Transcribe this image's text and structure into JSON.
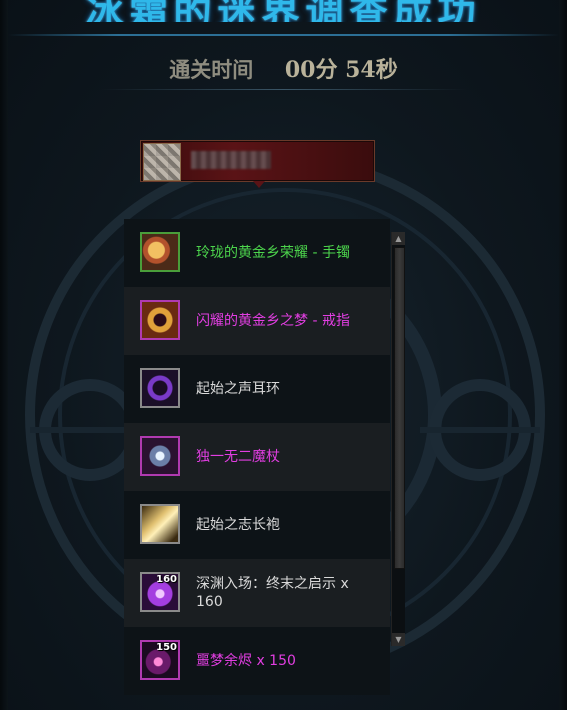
{
  "banner": {
    "title": "冰霜的迷界调查成功"
  },
  "clear_time": {
    "label": "通关时间",
    "value": "00分 54秒"
  },
  "player": {
    "name": ""
  },
  "rewards": [
    {
      "name": "玲珑的黄金乡荣耀 - 手镯",
      "quality": "epic",
      "icon": "bracelet-icon",
      "qty": ""
    },
    {
      "name": "闪耀的黄金乡之梦 - 戒指",
      "quality": "legend",
      "icon": "ring-icon",
      "qty": ""
    },
    {
      "name": "起始之声耳环",
      "quality": "unique",
      "icon": "earring-icon",
      "qty": ""
    },
    {
      "name": "独一无二魔杖",
      "quality": "legend",
      "icon": "wand-icon",
      "qty": ""
    },
    {
      "name": "起始之志长袍",
      "quality": "unique",
      "icon": "robe-icon",
      "qty": ""
    },
    {
      "name": "深渊入场：终末之启示 x 160",
      "quality": "unique",
      "icon": "abyss-orb-icon",
      "qty": "160"
    },
    {
      "name": "噩梦余烬 x 150",
      "quality": "legend",
      "icon": "ember-icon",
      "qty": "150"
    }
  ],
  "colors": {
    "epic": "#4cd44c",
    "legend": "#e13ee1",
    "unique": "#d9d9d9",
    "banner": "#2fb8ea"
  }
}
